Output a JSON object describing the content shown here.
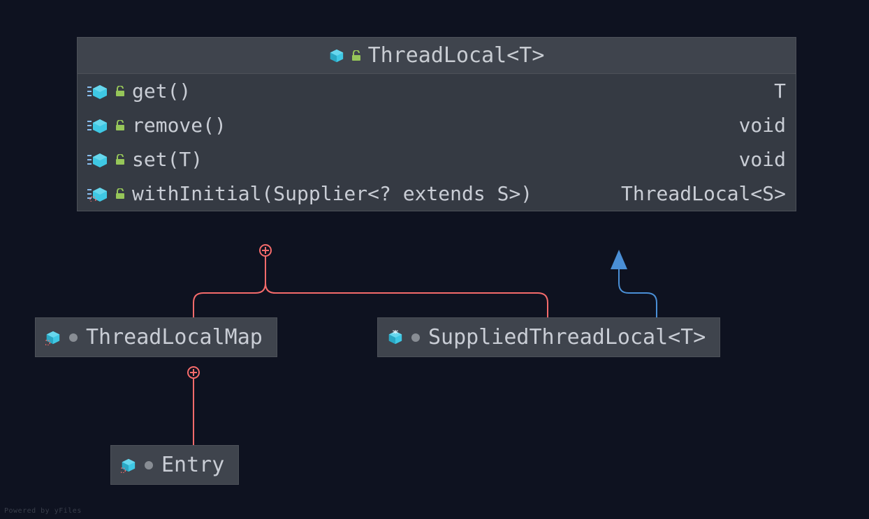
{
  "main_class": {
    "title": "ThreadLocal<T>",
    "members": [
      {
        "sig": "get()",
        "ret": "T"
      },
      {
        "sig": "remove()",
        "ret": "void"
      },
      {
        "sig": "set(T)",
        "ret": "void"
      },
      {
        "sig": "withInitial(Supplier<? extends S>)",
        "ret": "ThreadLocal<S>"
      }
    ]
  },
  "child_classes": {
    "map": "ThreadLocalMap",
    "supplied": "SuppliedThreadLocal<T>",
    "entry": "Entry"
  },
  "footer": "Powered by yFiles",
  "colors": {
    "bg": "#0e1220",
    "box": "#353a43",
    "box_header": "#3f444d",
    "border": "#4d5159",
    "text": "#c9cdd5",
    "cube": "#3fc8e4",
    "lock": "#96c659",
    "nesting": "#f56b6b",
    "inherit": "#4a8fd6"
  }
}
